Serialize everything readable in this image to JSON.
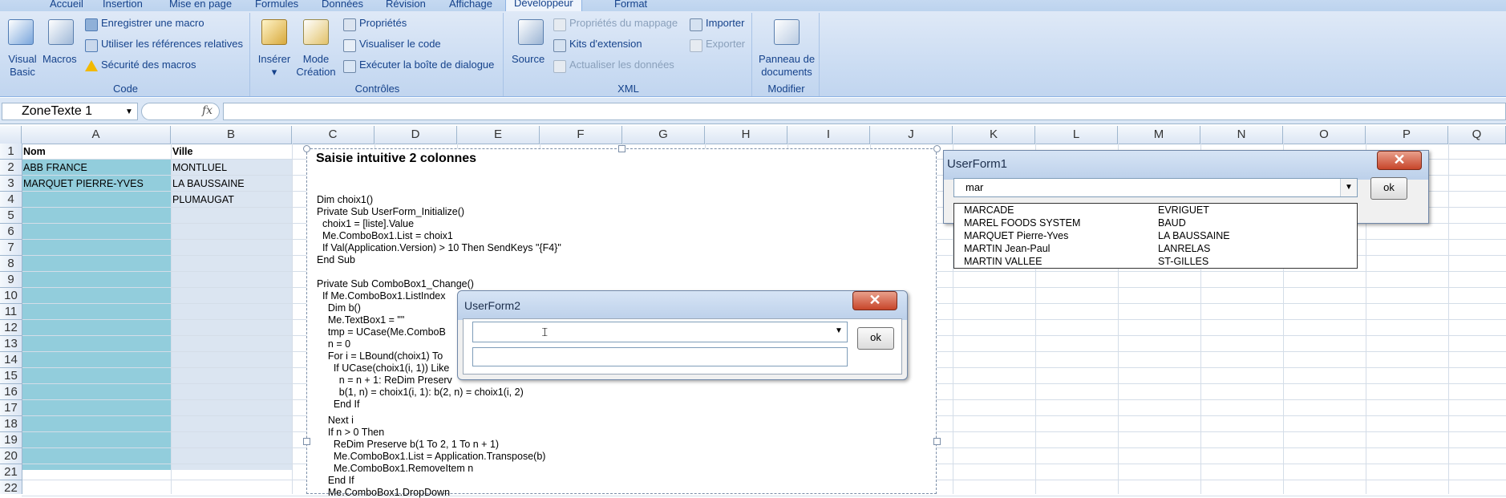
{
  "ribbon": {
    "tabs": [
      "Accueil",
      "Insertion",
      "Mise en page",
      "Formules",
      "Données",
      "Révision",
      "Affichage",
      "Développeur",
      "Format"
    ],
    "code_group": {
      "label": "Code",
      "visual_basic": "Visual Basic",
      "visual_basic_l1": "Visual",
      "visual_basic_l2": "Basic",
      "macros": "Macros",
      "record_macro": "Enregistrer une macro",
      "relative_refs": "Utiliser les références relatives",
      "macro_security": "Sécurité des macros"
    },
    "controls_group": {
      "label": "Contrôles",
      "insert": "Insérer",
      "design_mode_l1": "Mode",
      "design_mode_l2": "Création",
      "properties": "Propriétés",
      "view_code": "Visualiser le code",
      "run_dialog": "Exécuter la boîte de dialogue"
    },
    "xml_group": {
      "label": "XML",
      "source": "Source",
      "map_properties": "Propriétés du mappage",
      "extension_packs": "Kits d'extension",
      "refresh_data": "Actualiser les données",
      "import": "Importer",
      "export": "Exporter"
    },
    "modify_group": {
      "label": "Modifier",
      "doc_panel_l1": "Panneau de",
      "doc_panel_l2": "documents"
    }
  },
  "formula_bar": {
    "name_box": "ZoneTexte 1",
    "fx": "fx"
  },
  "grid": {
    "columns": [
      "A",
      "B",
      "C",
      "D",
      "E",
      "F",
      "G",
      "H",
      "I",
      "J",
      "K",
      "L",
      "M",
      "N",
      "O",
      "P",
      "Q"
    ],
    "rows": [
      "1",
      "2",
      "3",
      "4",
      "5",
      "6",
      "7",
      "8",
      "9",
      "10",
      "11",
      "12",
      "13",
      "14",
      "15",
      "16",
      "17",
      "18",
      "19",
      "20",
      "21",
      "22"
    ],
    "cells": {
      "A1": "Nom",
      "B1": "Ville",
      "A2": "ABB FRANCE",
      "B2": "MONTLUEL",
      "A3": "MARQUET PIERRE-YVES",
      "B3": "LA BAUSSAINE",
      "B4": "PLUMAUGAT"
    }
  },
  "textbox": {
    "title": "Saisie intuitive 2 colonnes",
    "lines": [
      "Dim choix1()",
      "Private Sub UserForm_Initialize()",
      "  choix1 = [liste].Value",
      "  Me.ComboBox1.List = choix1",
      "  If Val(Application.Version) > 10 Then SendKeys \"{F4}\"",
      "End Sub",
      "",
      "Private Sub ComboBox1_Change()",
      "  If Me.ComboBox1.ListIndex",
      "    Dim b()",
      "    Me.TextBox1 = \"\"",
      "    tmp = UCase(Me.ComboB",
      "    n = 0",
      "    For i = LBound(choix1) To",
      "      If UCase(choix1(i, 1)) Like",
      "        n = n + 1: ReDim Preserv",
      "        b(1, n) = choix1(i, 1): b(2, n) = choix1(i, 2)",
      "      End If",
      "    Next i",
      "    If n > 0 Then",
      "      ReDim Preserve b(1 To 2, 1 To n + 1)",
      "      Me.ComboBox1.List = Application.Transpose(b)",
      "      Me.ComboBox1.RemoveItem n",
      "    End If",
      "    Me.ComboBox1.DropDown"
    ]
  },
  "userform1": {
    "title": "UserForm1",
    "combo_value": "mar",
    "ok": "ok",
    "list": [
      {
        "name": "MARCADE",
        "city": "EVRIGUET"
      },
      {
        "name": "MAREL FOODS SYSTEM",
        "city": "BAUD"
      },
      {
        "name": "MARQUET Pierre-Yves",
        "city": "LA BAUSSAINE"
      },
      {
        "name": "MARTIN Jean-Paul",
        "city": "LANRELAS"
      },
      {
        "name": "MARTIN VALLEE",
        "city": "ST-GILLES"
      }
    ]
  },
  "userform2": {
    "title": "UserForm2",
    "ok": "ok"
  },
  "colors": {
    "selection_a": "#92cddc",
    "selection_b": "#dbe5f1",
    "ribbon_text": "#15428b"
  }
}
